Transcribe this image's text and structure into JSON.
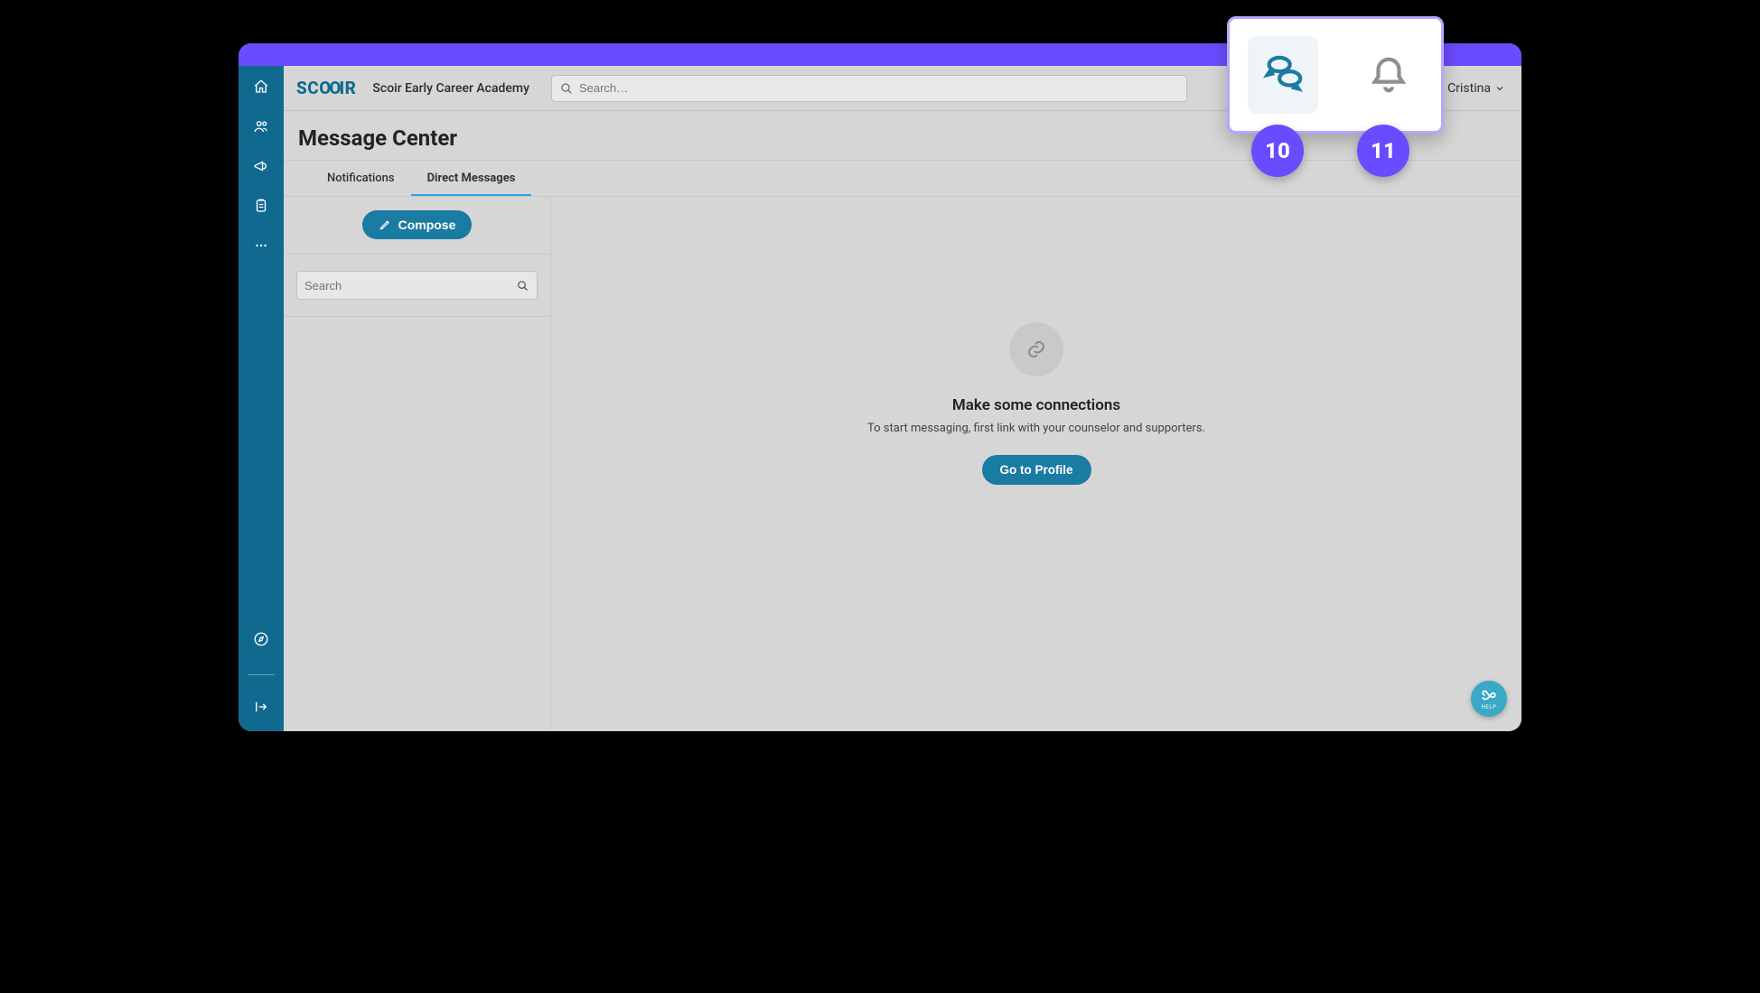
{
  "header": {
    "logo_text_1": "SC",
    "logo_text_2": "OO",
    "logo_text_3": "IR",
    "org_name": "Scoir Early Career Academy",
    "search_placeholder": "Search…",
    "user_name": "Cristina"
  },
  "page": {
    "title": "Message Center"
  },
  "tabs": {
    "notifications": "Notifications",
    "direct_messages": "Direct Messages"
  },
  "left": {
    "compose_label": "Compose",
    "search_placeholder": "Search"
  },
  "empty": {
    "title": "Make some connections",
    "subtitle": "To start messaging, first link with your counselor and supporters.",
    "button": "Go to Profile"
  },
  "help": {
    "label": "HELP"
  },
  "callout": {
    "badge_left": "10",
    "badge_right": "11"
  }
}
